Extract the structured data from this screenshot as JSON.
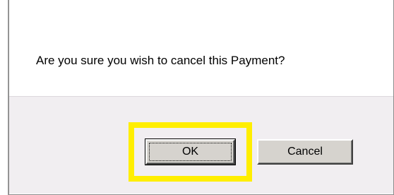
{
  "dialog": {
    "message": "Are you sure you wish to cancel this Payment?",
    "ok_label": "OK",
    "cancel_label": "Cancel"
  },
  "colors": {
    "highlight": "#ffee00",
    "button_face": "#d6d3ce",
    "button_area_bg": "#f1eef1"
  }
}
